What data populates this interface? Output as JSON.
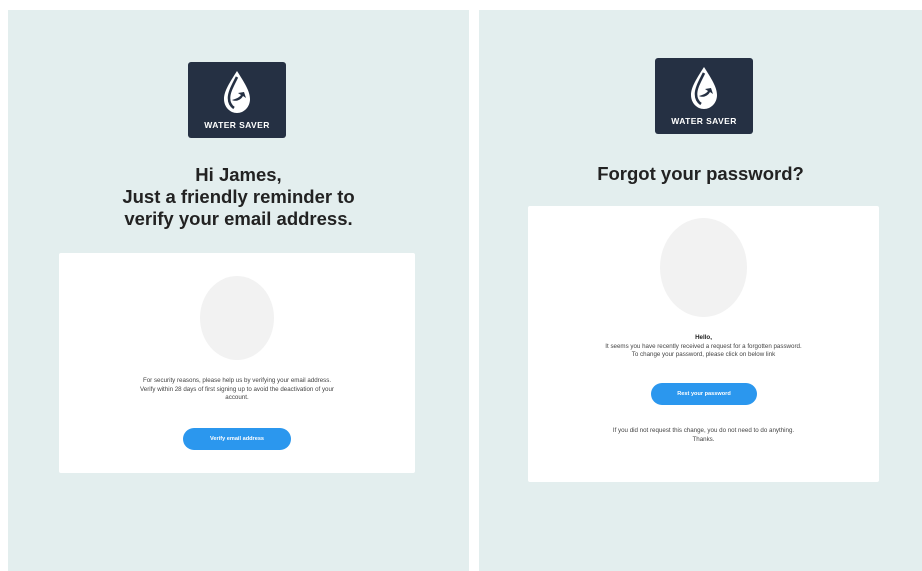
{
  "brand": {
    "name": "WATER SAVER",
    "logo_bg": "#253043",
    "logo_icon": "water-drop-icon"
  },
  "colors": {
    "background": "#e3eeee",
    "card": "#ffffff",
    "accent": "#2b97ee",
    "avatar": "#f2f2f2"
  },
  "verify_email": {
    "greeting_prefix": "Hi ",
    "user_name": "James",
    "greeting_suffix": ",",
    "headline_line2": "Just a friendly reminder to",
    "headline_line3": "verify your email address.",
    "body_line1": "For security reasons, please help us by verifying your email address.",
    "body_line2": "Verify within 28 days of first signing up to avoid the deactivation of your",
    "body_line3": "account.",
    "button_label": "Verify email address"
  },
  "forgot_password": {
    "headline": "Forgot your password?",
    "hello": "Hello,",
    "body_line1": "It seems you have recently received a request for a forgotten password.",
    "body_line2": "To change your password, please click on below link",
    "button_label": "Rest your password",
    "footer_line1": "If you did not request this change, you do not need to do anything.",
    "footer_line2": "Thanks."
  }
}
